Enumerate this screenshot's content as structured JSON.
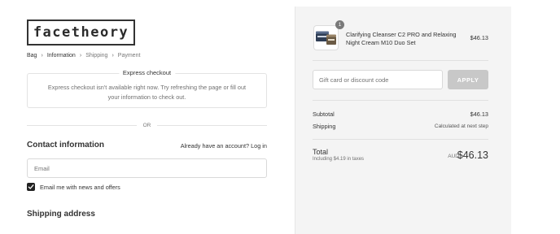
{
  "brand": {
    "logo_text": "facetheory"
  },
  "breadcrumb": [
    {
      "label": "Bag"
    },
    {
      "label": "Information"
    },
    {
      "label": "Shipping"
    },
    {
      "label": "Payment"
    }
  ],
  "express_checkout": {
    "title": "Express checkout",
    "message": "Express checkout isn't available right now. Try refreshing the page or fill out your information to check out."
  },
  "divider_text": "OR",
  "contact": {
    "title": "Contact information",
    "account_prompt": "Already have an account?",
    "login_link": "Log in",
    "email_placeholder": "Email",
    "email_value": "",
    "news_offers_label": "Email me with news and offers",
    "news_offers_checked": true
  },
  "shipping_address": {
    "title": "Shipping address"
  },
  "order_summary": {
    "product": {
      "quantity": "1",
      "name": "Clarifying Cleanser C2 PRO and Relaxing Night Cream M10 Duo Set",
      "price": "$46.13"
    },
    "discount": {
      "placeholder": "Gift card or discount code",
      "value": "",
      "apply_label": "APPLY"
    },
    "subtotal": {
      "label": "Subtotal",
      "value": "$46.13"
    },
    "shipping": {
      "label": "Shipping",
      "value": "Calculated at next step"
    },
    "total": {
      "label": "Total",
      "taxes_note": "Including $4.19 in taxes",
      "currency": "AUD",
      "amount": "$46.13"
    }
  },
  "colors": {
    "text": "#333333",
    "summary_background": "#f4f4f4",
    "apply_button": "#c8c8c8",
    "checkbox": "#222222"
  }
}
